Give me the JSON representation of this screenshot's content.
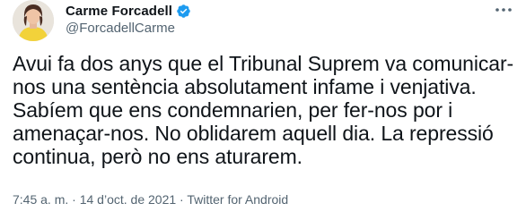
{
  "author": {
    "name": "Carme Forcadell",
    "handle": "@ForcadellCarme",
    "verified_icon": "verified-badge-icon",
    "avatar_icon": "avatar"
  },
  "more_icon": "more-options-icon",
  "tweet": {
    "text": "Avui fa dos anys que el Tribunal Suprem va comunicar-\nnos una sentència absolutament infame i venjativa.\nSabíem que ens condemnarien, per fer-nos por i\namenaçar-nos. No oblidarem aquell dia. La repressió\ncontinua, però no ens aturarem."
  },
  "meta": {
    "time": "7:45 a. m.",
    "sep1": " · ",
    "date": "14 d’oct. de 2021",
    "sep2": " · ",
    "source": "Twitter for Android"
  },
  "colors": {
    "text": "#0f1419",
    "secondary": "#536471",
    "verified": "#1d9bf0"
  }
}
